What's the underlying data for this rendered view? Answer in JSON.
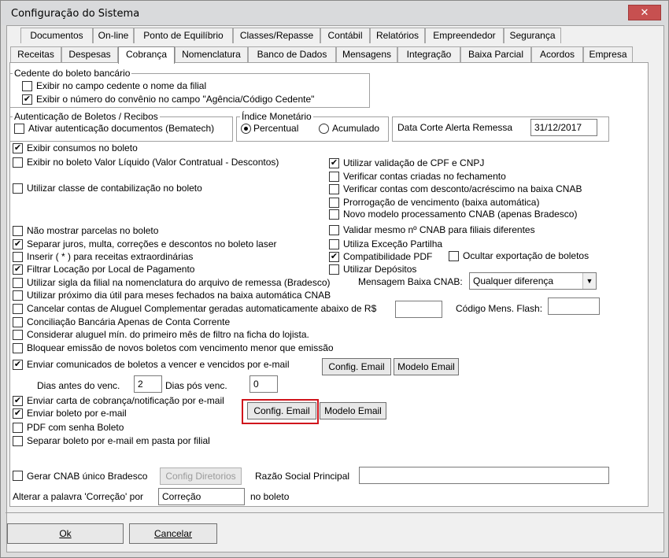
{
  "window": {
    "title": "Configuração do Sistema",
    "close_glyph": "✕"
  },
  "tabs_row1": [
    "Documentos",
    "On-line",
    "Ponto de Equilíbrio",
    "Classes/Repasse",
    "Contábil",
    "Relatórios",
    "Empreendedor",
    "Segurança"
  ],
  "tabs_row2": [
    "Receitas",
    "Despesas",
    "Cobrança",
    "Nomenclatura",
    "Banco de Dados",
    "Mensagens",
    "Integração",
    "Baixa Parcial",
    "Acordos",
    "Empresa"
  ],
  "cedente": {
    "title": "Cedente do boleto bancário",
    "items": [
      {
        "label": "Exibir no campo cedente o nome da filial",
        "checked": false
      },
      {
        "label": "Exibir o número do convênio no campo \"Agência/Código Cedente\"",
        "checked": true
      }
    ]
  },
  "autenticacao": {
    "title": "Autenticação de Boletos / Recibos",
    "item": {
      "label": "Ativar autenticação documentos (Bematech)",
      "checked": false
    }
  },
  "indice": {
    "title": "Índice Monetário",
    "options": [
      {
        "label": "Percentual",
        "selected": true
      },
      {
        "label": "Acumulado",
        "selected": false
      }
    ]
  },
  "data_corte": {
    "label": "Data Corte Alerta Remessa",
    "value": "31/12/2017"
  },
  "left_checks": [
    {
      "label": "Exibir consumos no boleto",
      "checked": true
    },
    {
      "label": "Exibir no boleto Valor Líquido (Valor Contratual - Descontos)",
      "checked": false
    },
    {
      "label": "Utilizar classe de contabilização no boleto",
      "checked": false
    },
    {
      "label": "Não mostrar parcelas no boleto",
      "checked": false
    },
    {
      "label": "Separar juros, multa, correções e descontos no boleto laser",
      "checked": true
    },
    {
      "label": "Inserir ( * ) para receitas extraordinárias",
      "checked": false
    },
    {
      "label": "Filtrar Locação por Local de Pagamento",
      "checked": true
    },
    {
      "label": "Utilizar sigla da filial na nomenclatura do arquivo de remessa (Bradesco)",
      "checked": false
    },
    {
      "label": "Utilizar próximo dia útil para meses fechados na baixa automática CNAB",
      "checked": false
    },
    {
      "label": "Cancelar contas de Aluguel Complementar geradas automaticamente abaixo de R$",
      "checked": false
    },
    {
      "label": "Conciliação Bancária Apenas de Conta Corrente",
      "checked": false
    },
    {
      "label": "Considerar aluguel mín. do primeiro mês de filtro na ficha do lojista.",
      "checked": false
    },
    {
      "label": "Bloquear emissão de novos boletos com vencimento menor que emissão",
      "checked": false
    },
    {
      "label": "Enviar comunicados de boletos a vencer e vencidos por e-mail",
      "checked": true
    }
  ],
  "right_checks": [
    {
      "label": "Utilizar validação de CPF e CNPJ",
      "checked": true
    },
    {
      "label": "Verificar contas criadas no fechamento",
      "checked": false
    },
    {
      "label": "Verificar contas com desconto/acréscimo na baixa CNAB",
      "checked": false
    },
    {
      "label": "Prorrogação de vencimento (baixa automática)",
      "checked": false
    },
    {
      "label": "Novo modelo processamento CNAB (apenas Bradesco)",
      "checked": false
    },
    {
      "label": "Validar mesmo nº CNAB para filiais diferentes",
      "checked": false
    },
    {
      "label": "Utiliza Exceção Partilha",
      "checked": false
    },
    {
      "label": "Compatibilidade PDF",
      "checked": true
    },
    {
      "label": "Utilizar Depósitos",
      "checked": false
    }
  ],
  "ocultar": {
    "label": "Ocultar exportação de boletos",
    "checked": false
  },
  "mensagem_baixa": {
    "label": "Mensagem Baixa CNAB:",
    "value": "Qualquer diferença",
    "arrow": "▼"
  },
  "codigo_flash": {
    "label": "Código Mens. Flash:",
    "value": ""
  },
  "cancelar_valor": "",
  "comunicados_buttons": {
    "config": "Config. Email",
    "modelo": "Modelo Email"
  },
  "dias": {
    "antes_label": "Dias antes do venc.",
    "antes_value": "2",
    "pos_label": "Dias pós venc.",
    "pos_value": "0"
  },
  "email_checks": [
    {
      "label": "Enviar carta de cobrança/notificação por e-mail",
      "checked": true
    },
    {
      "label": "Enviar boleto por e-mail",
      "checked": true
    },
    {
      "label": "PDF com senha Boleto",
      "checked": false
    },
    {
      "label": "Separar boleto por e-mail em pasta por filial",
      "checked": false
    }
  ],
  "boleto_buttons": {
    "config": "Config. Email",
    "modelo": "Modelo Email"
  },
  "cnab_unico": {
    "label": "Gerar CNAB único Bradesco",
    "checked": false,
    "button": "Config Diretorios"
  },
  "razao": {
    "label": "Razão Social Principal",
    "value": ""
  },
  "correcao": {
    "label": "Alterar a palavra 'Correção' por",
    "value": "Correção",
    "suffix": "no boleto"
  },
  "footer": {
    "ok": "Ok",
    "cancel": "Cancelar"
  },
  "check_glyph": "✔"
}
